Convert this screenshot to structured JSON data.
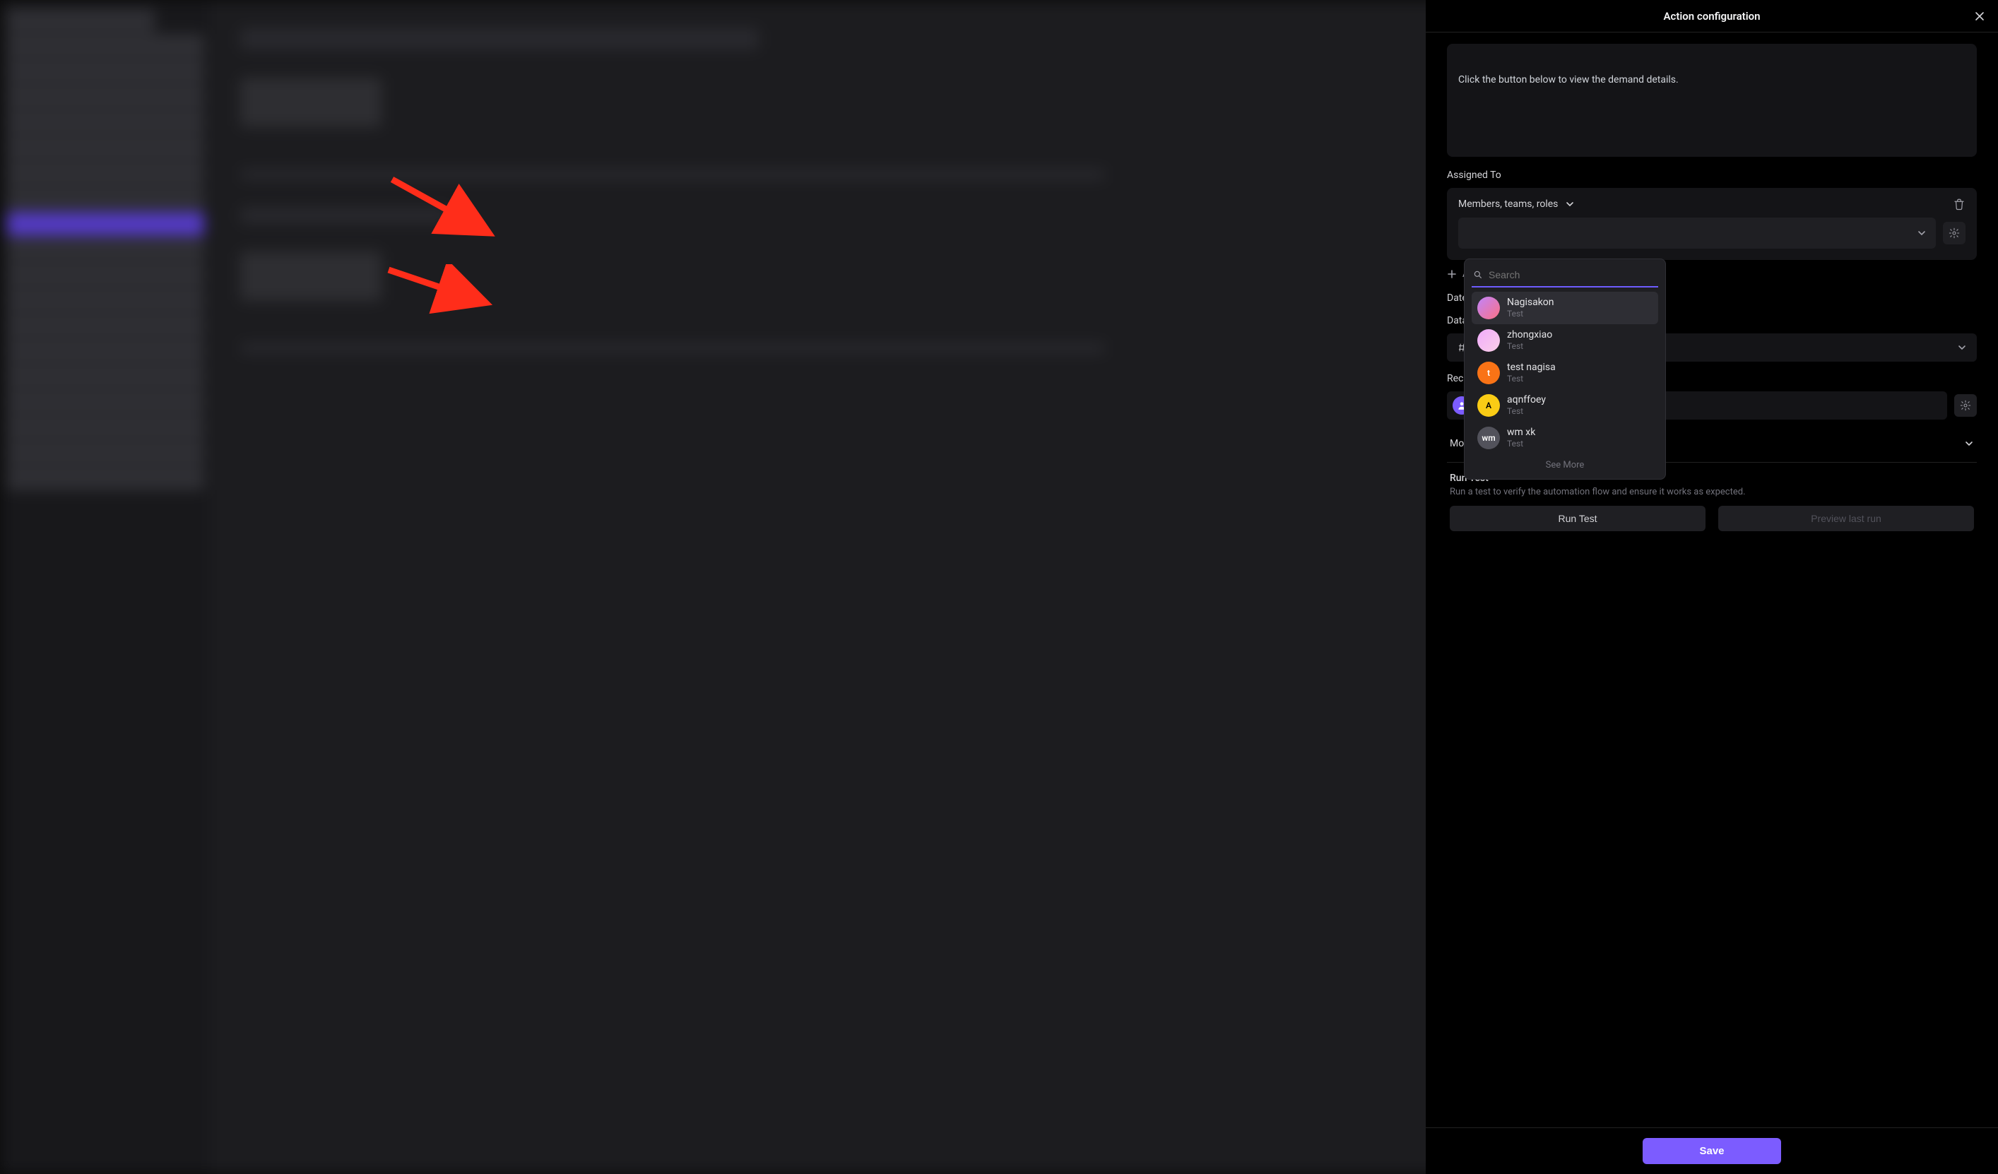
{
  "panel": {
    "title": "Action configuration",
    "preview_text": "Click the button below to view the demand details.",
    "assigned_to_label": "Assigned To",
    "assigned_type": "Members, teams, roles",
    "add_field": "Add Field",
    "date_label": "Date",
    "database_label": "Database",
    "database_placeholder": "",
    "recipient_label": "Recipient",
    "more_options": "More options",
    "run_test": {
      "title": "Run Test",
      "desc": "Run a test to verify the automation flow and ensure it works as expected.",
      "run_btn": "Run Test",
      "preview_btn": "Preview last run"
    },
    "save": "Save"
  },
  "dropdown": {
    "search_placeholder": "Search",
    "see_more": "See More",
    "items": [
      {
        "name": "Nagisakon",
        "sub": "Test",
        "avatar_class": "img1",
        "initials": "",
        "selected": true
      },
      {
        "name": "zhongxiao",
        "sub": "Test",
        "avatar_class": "img2",
        "initials": "",
        "selected": false
      },
      {
        "name": "test nagisa",
        "sub": "Test",
        "avatar_class": "orange",
        "initials": "t",
        "selected": false
      },
      {
        "name": "aqnffoey",
        "sub": "Test",
        "avatar_class": "yellow",
        "initials": "A",
        "selected": false
      },
      {
        "name": "wm xk",
        "sub": "Test",
        "avatar_class": "grey",
        "initials": "wm",
        "selected": false
      }
    ]
  }
}
